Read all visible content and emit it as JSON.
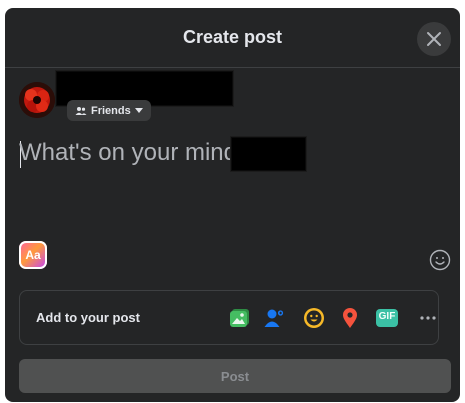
{
  "dialog": {
    "title": "Create post"
  },
  "author": {
    "audience_label": "Friends"
  },
  "composer": {
    "placeholder": "What's on your mind,"
  },
  "background_picker": {
    "label": "Aa"
  },
  "add_to_post": {
    "label": "Add to your post",
    "icons": [
      "photo-video-icon",
      "tag-people-icon",
      "feeling-activity-icon",
      "check-in-icon",
      "gif-icon",
      "more-icon"
    ],
    "gif_label": "GIF"
  },
  "post_button": {
    "label": "Post"
  },
  "colors": {
    "dialog_bg": "#242526",
    "photo": "#45bd62",
    "tag": "#1877f2",
    "feeling": "#f7b928",
    "checkin": "#f5533d",
    "gif": "#3bc1a5"
  }
}
